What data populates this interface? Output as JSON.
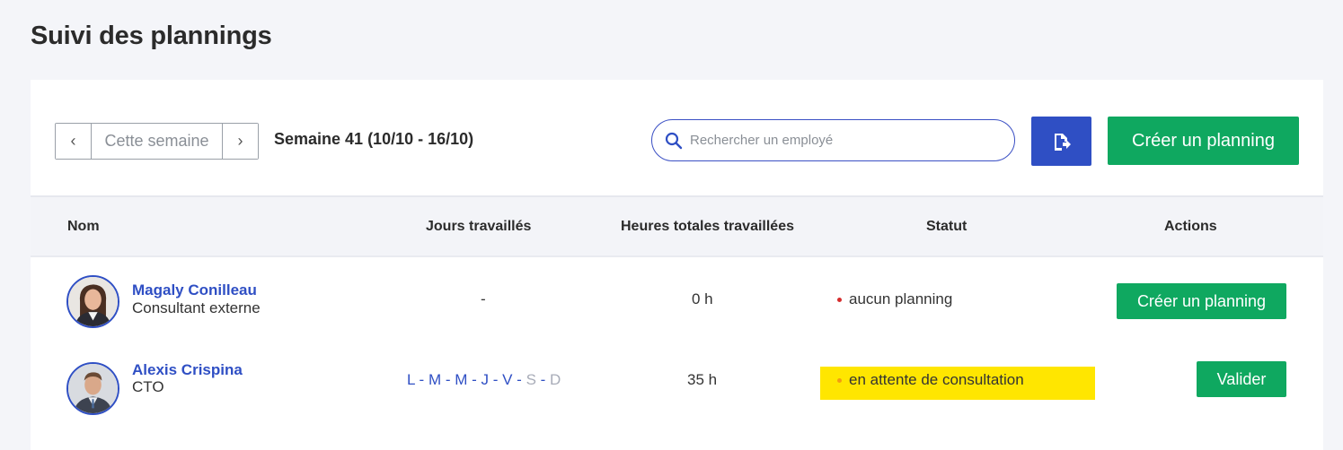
{
  "page": {
    "title": "Suivi des plannings"
  },
  "toolbar": {
    "prev_symbol": "‹",
    "next_symbol": "›",
    "current_label": "Cette semaine",
    "week_label": "Semaine 41 (10/10 - 16/10)",
    "search_placeholder": "Rechercher un employé",
    "export_icon": "document-export-icon",
    "create_label": "Créer un planning"
  },
  "table": {
    "headers": {
      "name": "Nom",
      "days": "Jours travaillés",
      "hours": "Heures totales travaillées",
      "status": "Statut",
      "actions": "Actions"
    },
    "rows": [
      {
        "name": "Magaly Conilleau",
        "role": "Consultant externe",
        "days_text": "-",
        "hours": "0 h",
        "status": "aucun planning",
        "status_color": "#d62d2d",
        "action": "Créer un planning"
      },
      {
        "name": "Alexis Crispina",
        "role": "CTO",
        "days": [
          "L",
          "M",
          "M",
          "J",
          "V",
          "S",
          "D"
        ],
        "days_worked": [
          true,
          true,
          true,
          true,
          true,
          false,
          false
        ],
        "days_separator": "-",
        "hours": "35 h",
        "status": "en attente de consultation",
        "status_color": "#f39c12",
        "status_highlight": "#ffe600",
        "action": "Valider"
      }
    ]
  },
  "colors": {
    "primary": "#2f4fc4",
    "success": "#0fa860",
    "background": "#f4f5f9"
  }
}
